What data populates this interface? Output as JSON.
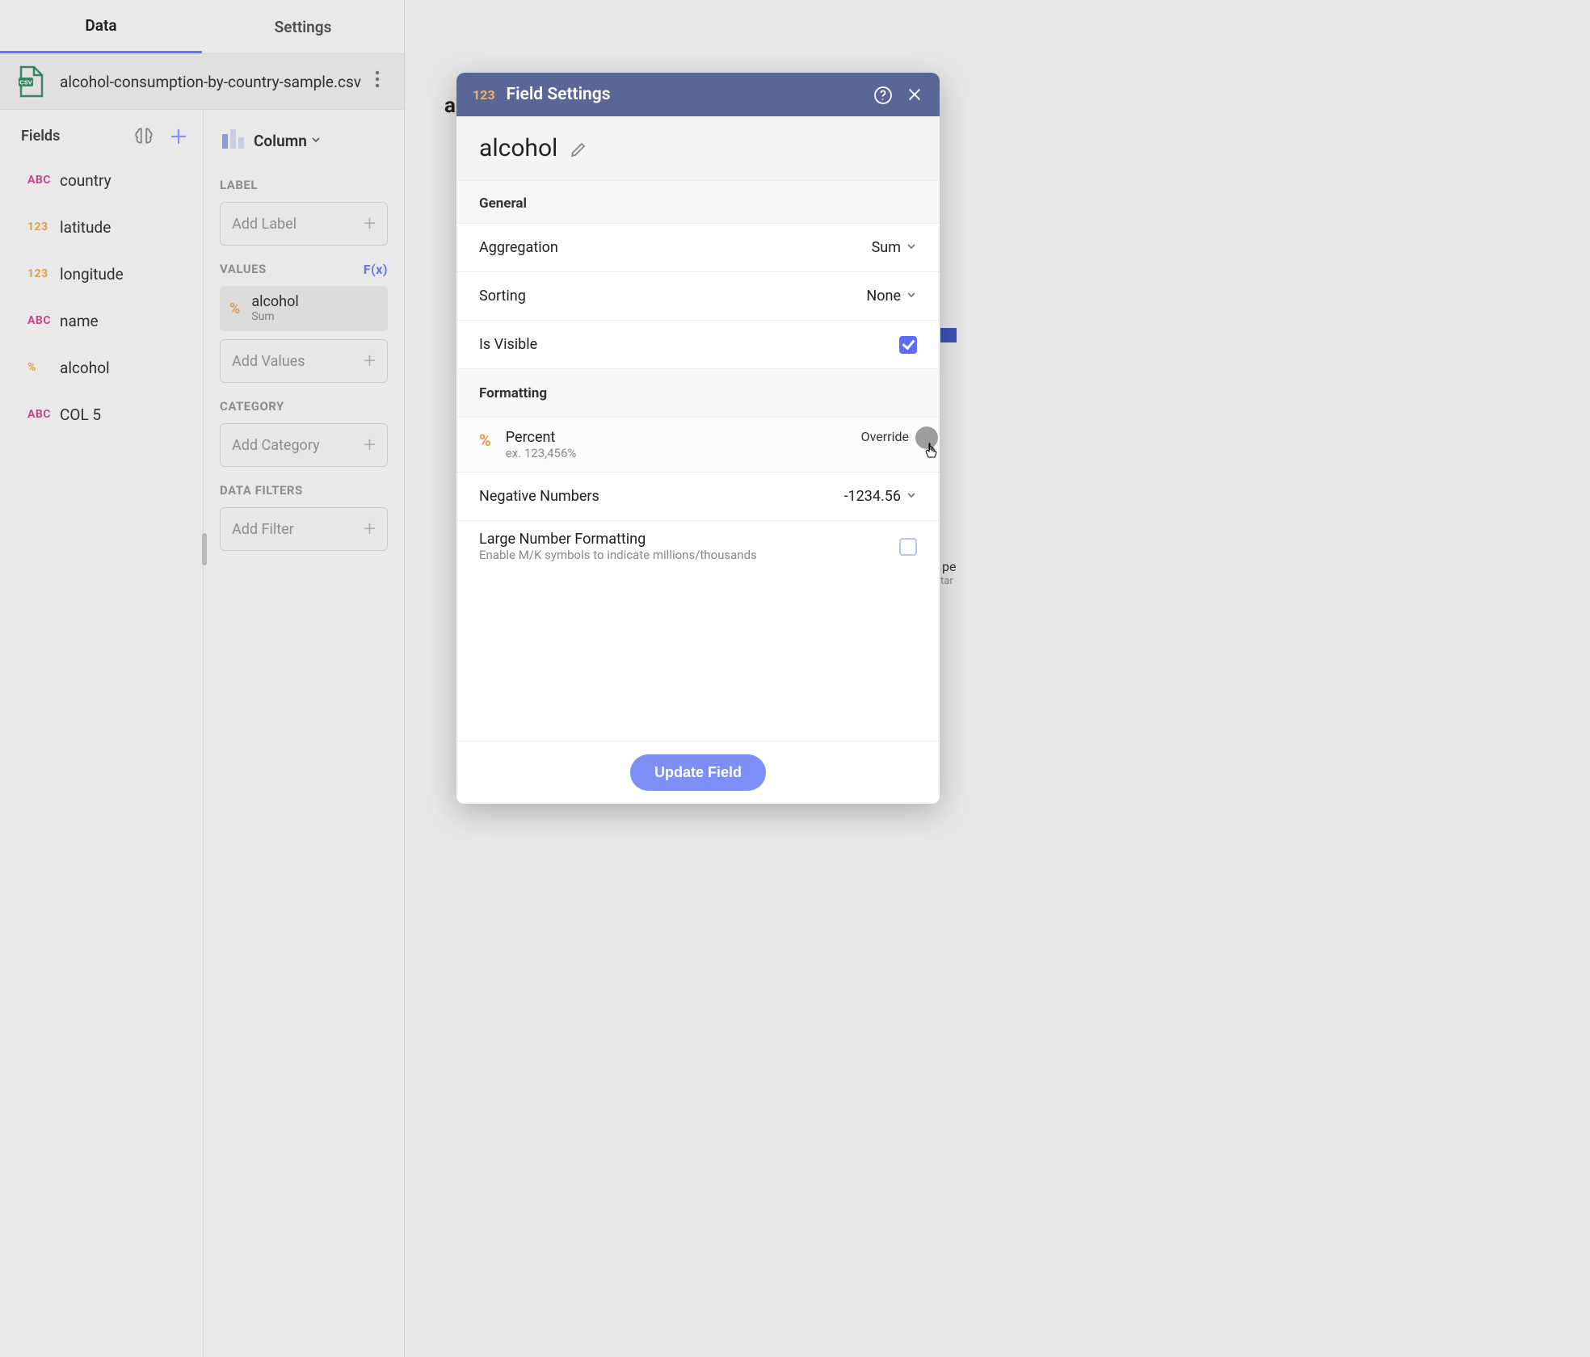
{
  "tabs": {
    "data": "Data",
    "settings": "Settings"
  },
  "file": {
    "name": "alcohol-consumption-by-country-sample.csv"
  },
  "fields_header": "Fields",
  "fields": [
    {
      "type": "ABC",
      "cls": "type-abc",
      "label": "country"
    },
    {
      "type": "123",
      "cls": "type-123",
      "label": "latitude"
    },
    {
      "type": "123",
      "cls": "type-123",
      "label": "longitude"
    },
    {
      "type": "ABC",
      "cls": "type-abc",
      "label": "name"
    },
    {
      "type": "%",
      "cls": "type-pct",
      "label": "alcohol"
    },
    {
      "type": "ABC",
      "cls": "type-abc",
      "label": "COL 5"
    }
  ],
  "chart_type": "Column",
  "sections": {
    "label_title": "LABEL",
    "label_placeholder": "Add Label",
    "values_title": "VALUES",
    "fx": "F(x)",
    "value_chip": {
      "name": "alcohol",
      "agg": "Sum"
    },
    "values_placeholder": "Add Values",
    "category_title": "CATEGORY",
    "category_placeholder": "Add Category",
    "filters_title": "DATA FILTERS",
    "filters_placeholder": "Add Filter"
  },
  "dialog": {
    "badge": "123",
    "title": "Field Settings",
    "field_name": "alcohol",
    "general": "General",
    "aggregation": {
      "label": "Aggregation",
      "value": "Sum"
    },
    "sorting": {
      "label": "Sorting",
      "value": "None"
    },
    "is_visible": {
      "label": "Is Visible"
    },
    "formatting": "Formatting",
    "percent": {
      "title": "Percent",
      "example": "ex. 123,456%",
      "override": "Override"
    },
    "negative": {
      "label": "Negative Numbers",
      "value": "-1234.56"
    },
    "large": {
      "label": "Large Number Formatting",
      "sub": "Enable M/K symbols to indicate millions/thousands"
    },
    "update": "Update Field"
  },
  "bg_peek": {
    "line1": "pe",
    "line2": "tar"
  }
}
